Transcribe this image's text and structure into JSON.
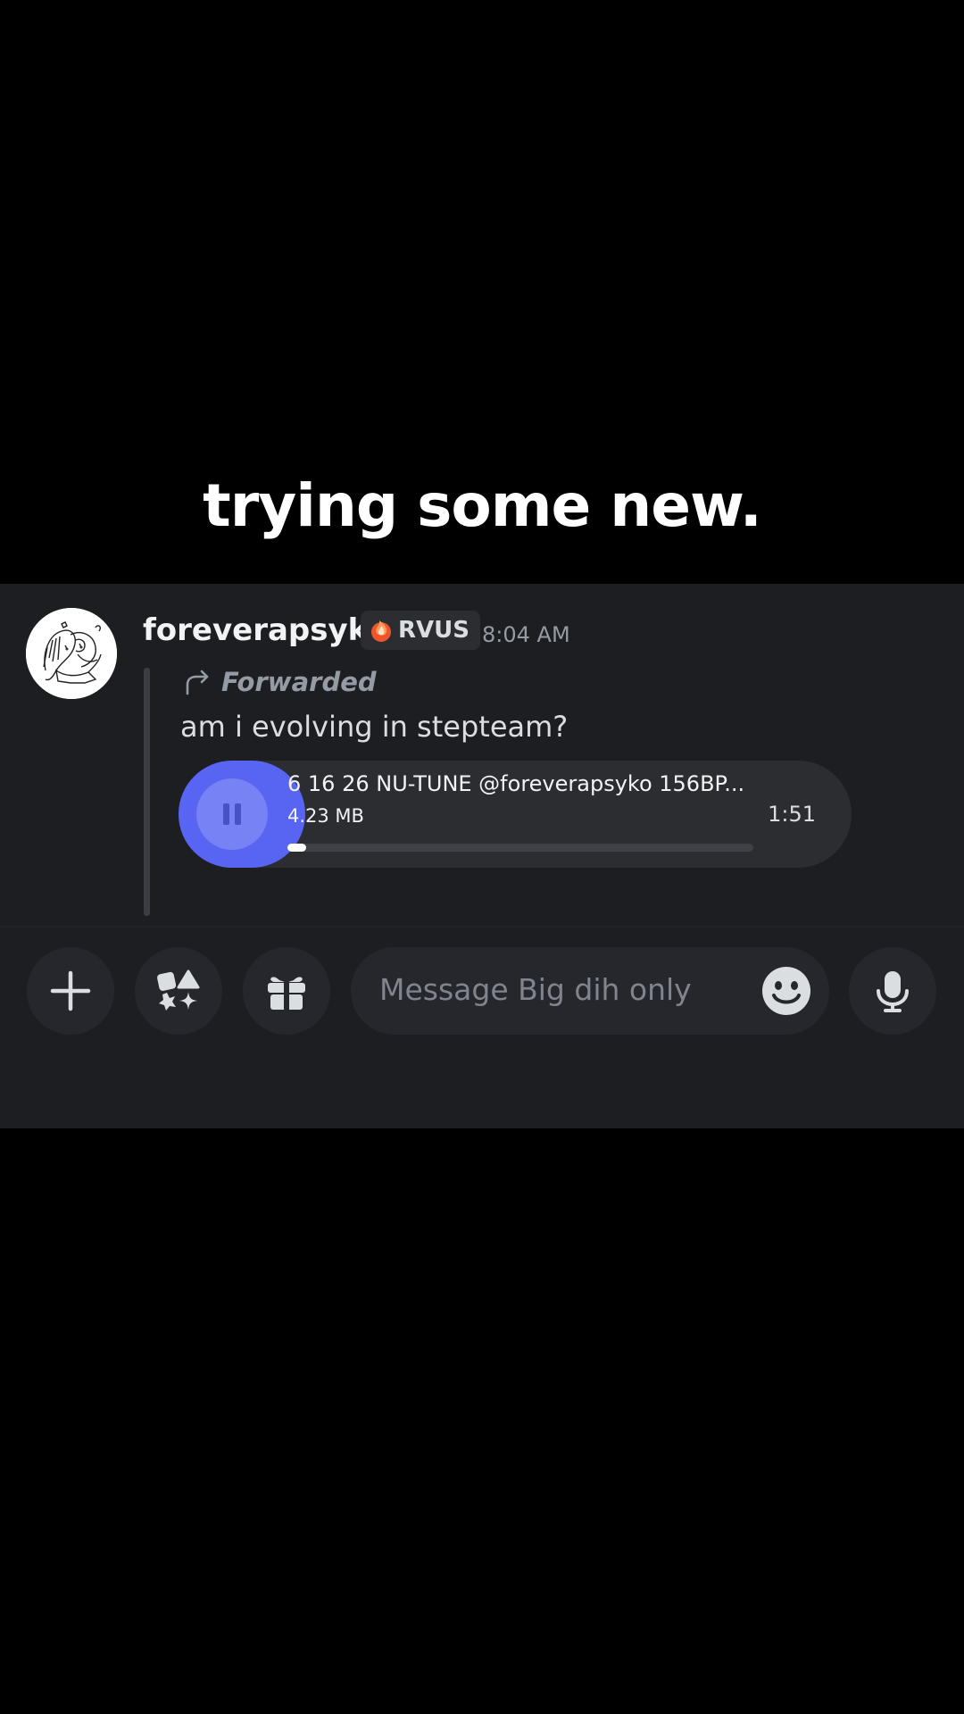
{
  "caption": "trying some new.",
  "message": {
    "username": "foreverapsyko",
    "badge": {
      "icon": "flame-tag-icon",
      "label": "RVUS"
    },
    "timestamp": "8:04 AM",
    "forwarded_label": "Forwarded",
    "text": "am i evolving in stepteam?",
    "attachment": {
      "type": "audio",
      "title": "6 16 26 NU-TUNE @foreverapsyko 156BP...",
      "size": "4.23 MB",
      "duration": "1:51",
      "state": "playing",
      "progress": 0.04
    }
  },
  "composer": {
    "placeholder": "Message Big dih only",
    "buttons": [
      "plus-icon",
      "apps-icon",
      "gift-icon",
      "emoji-icon",
      "microphone-icon"
    ]
  },
  "colors": {
    "accent": "#5865f2",
    "background": "#1d1e22",
    "surface": "#2b2d31"
  }
}
